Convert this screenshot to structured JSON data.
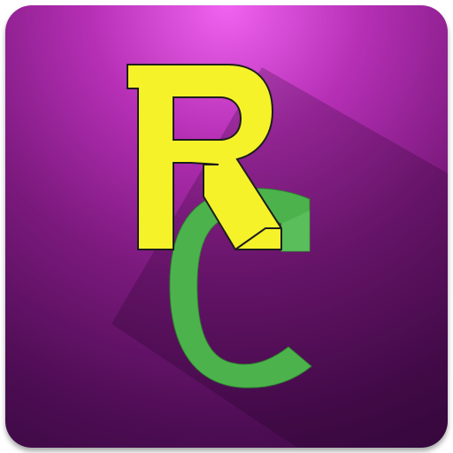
{
  "icon": {
    "name": "rc-app-icon",
    "letters": [
      "R",
      "C"
    ],
    "colors": {
      "tile_light": "#f063f0",
      "tile_mid": "#7d1a7f",
      "tile_dark": "#3f0a46",
      "letter_r_fill": "#f5f22a",
      "letter_r_outline": "#1d1d1d",
      "letter_c_fill": "#4cb34c",
      "letter_c_highlight": "#66c766"
    }
  }
}
